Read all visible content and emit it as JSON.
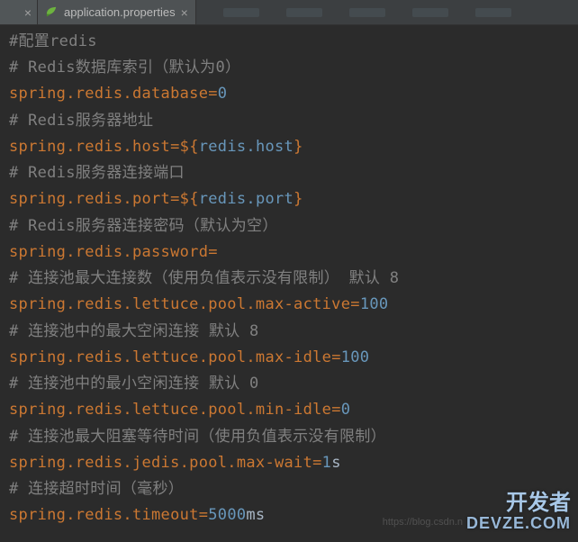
{
  "tab": {
    "filename": "application.properties",
    "close_label": "×"
  },
  "lines": [
    {
      "type": "comment",
      "text": "#配置redis"
    },
    {
      "type": "comment",
      "text": "# Redis数据库索引（默认为0）"
    },
    {
      "type": "prop_num",
      "key": "spring.redis.database",
      "value": "0"
    },
    {
      "type": "comment",
      "text": "# Redis服务器地址"
    },
    {
      "type": "prop_var",
      "key": "spring.redis.host",
      "var": "redis.host"
    },
    {
      "type": "comment",
      "text": "# Redis服务器连接端口"
    },
    {
      "type": "prop_var",
      "key": "spring.redis.port",
      "var": "redis.port"
    },
    {
      "type": "comment",
      "text": "# Redis服务器连接密码（默认为空）"
    },
    {
      "type": "prop_empty",
      "key": "spring.redis.password"
    },
    {
      "type": "comment",
      "text": "# 连接池最大连接数（使用负值表示没有限制） 默认 8"
    },
    {
      "type": "prop_num",
      "key": "spring.redis.lettuce.pool.max-active",
      "value": "100"
    },
    {
      "type": "comment",
      "text": "# 连接池中的最大空闲连接 默认 8"
    },
    {
      "type": "prop_num",
      "key": "spring.redis.lettuce.pool.max-idle",
      "value": "100"
    },
    {
      "type": "comment",
      "text": "# 连接池中的最小空闲连接 默认 0"
    },
    {
      "type": "prop_num",
      "key": "spring.redis.lettuce.pool.min-idle",
      "value": "0"
    },
    {
      "type": "comment",
      "text": "# 连接池最大阻塞等待时间（使用负值表示没有限制）"
    },
    {
      "type": "prop_mixed",
      "key": "spring.redis.jedis.pool.max-wait",
      "num": "1",
      "suffix": "s"
    },
    {
      "type": "comment",
      "text": "# 连接超时时间（毫秒）"
    },
    {
      "type": "prop_mixed",
      "key": "spring.redis.timeout",
      "num": "5000",
      "suffix": "ms"
    }
  ],
  "watermark": {
    "url": "https://blog.csdn.n",
    "top_text": "开发者",
    "bottom_text": "DEVZE.COM"
  }
}
